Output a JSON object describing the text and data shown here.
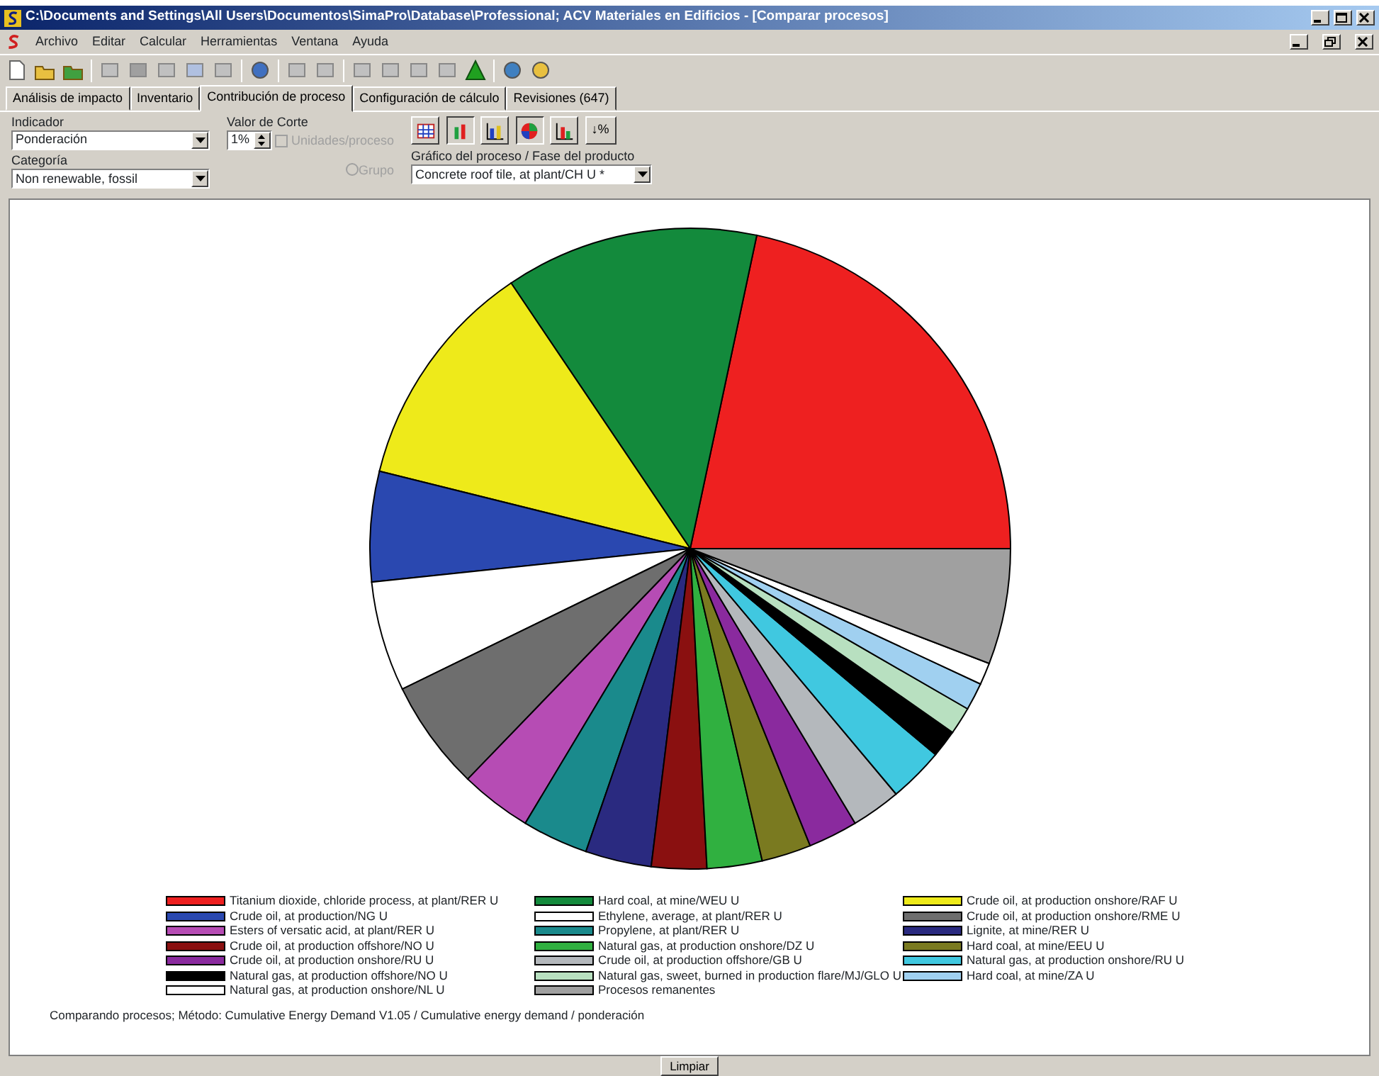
{
  "window": {
    "title": "C:\\Documents and Settings\\All Users\\Documentos\\SimaPro\\Database\\Professional; ACV Materiales en Edificios - [Comparar procesos]"
  },
  "menu": [
    "Archivo",
    "Editar",
    "Calcular",
    "Herramientas",
    "Ventana",
    "Ayuda"
  ],
  "tabs": [
    {
      "label": "Análisis de impacto",
      "selected": false
    },
    {
      "label": "Inventario",
      "selected": false
    },
    {
      "label": "Contribución de proceso",
      "selected": true
    },
    {
      "label": "Configuración de cálculo",
      "selected": false
    },
    {
      "label": "Revisiones (647)",
      "selected": false
    }
  ],
  "controls": {
    "indicator_label": "Indicador",
    "indicator_value": "Ponderación",
    "cutoff_label": "Valor de Corte",
    "cutoff_value": "1%",
    "units_checkbox": {
      "label": "Unidades/proceso",
      "checked": false,
      "disabled": true
    },
    "category_label": "Categoría",
    "category_value": "Non renewable, fossil",
    "group_radio": {
      "label": "Grupo",
      "checked": false,
      "disabled": true
    },
    "process_label": "Gráfico del proceso / Fase del producto",
    "process_value": "Concrete roof tile, at plant/CH U *",
    "percent_button": "↓%"
  },
  "legend": [
    {
      "label": "Titanium dioxide, chloride process, at plant/RER U",
      "color": "#ee2020"
    },
    {
      "label": "Hard coal, at mine/WEU U",
      "color": "#138a3c"
    },
    {
      "label": "Crude oil, at production onshore/RAF U",
      "color": "#eeea1a"
    },
    {
      "label": "Crude oil, at production/NG U",
      "color": "#2a48b0"
    },
    {
      "label": "Ethylene, average, at plant/RER U",
      "color": "#ffffff"
    },
    {
      "label": "Crude oil, at production onshore/RME U",
      "color": "#6e6e6e"
    },
    {
      "label": "Esters of versatic acid, at plant/RER U",
      "color": "#b64cb4"
    },
    {
      "label": "Propylene, at plant/RER U",
      "color": "#1a8a8c"
    },
    {
      "label": "Lignite, at mine/RER U",
      "color": "#2a2a80"
    },
    {
      "label": "Crude oil, at production offshore/NO U",
      "color": "#8a1010"
    },
    {
      "label": "Natural gas, at production onshore/DZ U",
      "color": "#30b040"
    },
    {
      "label": "Hard coal, at mine/EEU U",
      "color": "#7a7a20"
    },
    {
      "label": "Crude oil, at production onshore/RU U",
      "color": "#8a2a9e"
    },
    {
      "label": "Crude oil, at production offshore/GB U",
      "color": "#b4b8bc"
    },
    {
      "label": "Natural gas, at production onshore/RU U",
      "color": "#40c8e0"
    },
    {
      "label": "Natural gas, at production offshore/NO U",
      "color": "#000000"
    },
    {
      "label": "Natural gas, sweet, burned in production flare/MJ/GLO U",
      "color": "#b8e0c0"
    },
    {
      "label": "Hard coal, at mine/ZA U",
      "color": "#a0d0f0"
    },
    {
      "label": "Natural gas, at production onshore/NL U",
      "color": "#ffffff"
    },
    {
      "label": "Procesos remanentes",
      "color": "#a0a0a0"
    }
  ],
  "caption": "Comparando procesos;  Método: Cumulative Energy Demand V1.05 /  Cumulative energy demand / ponderación",
  "footer_button": "Limpiar"
}
